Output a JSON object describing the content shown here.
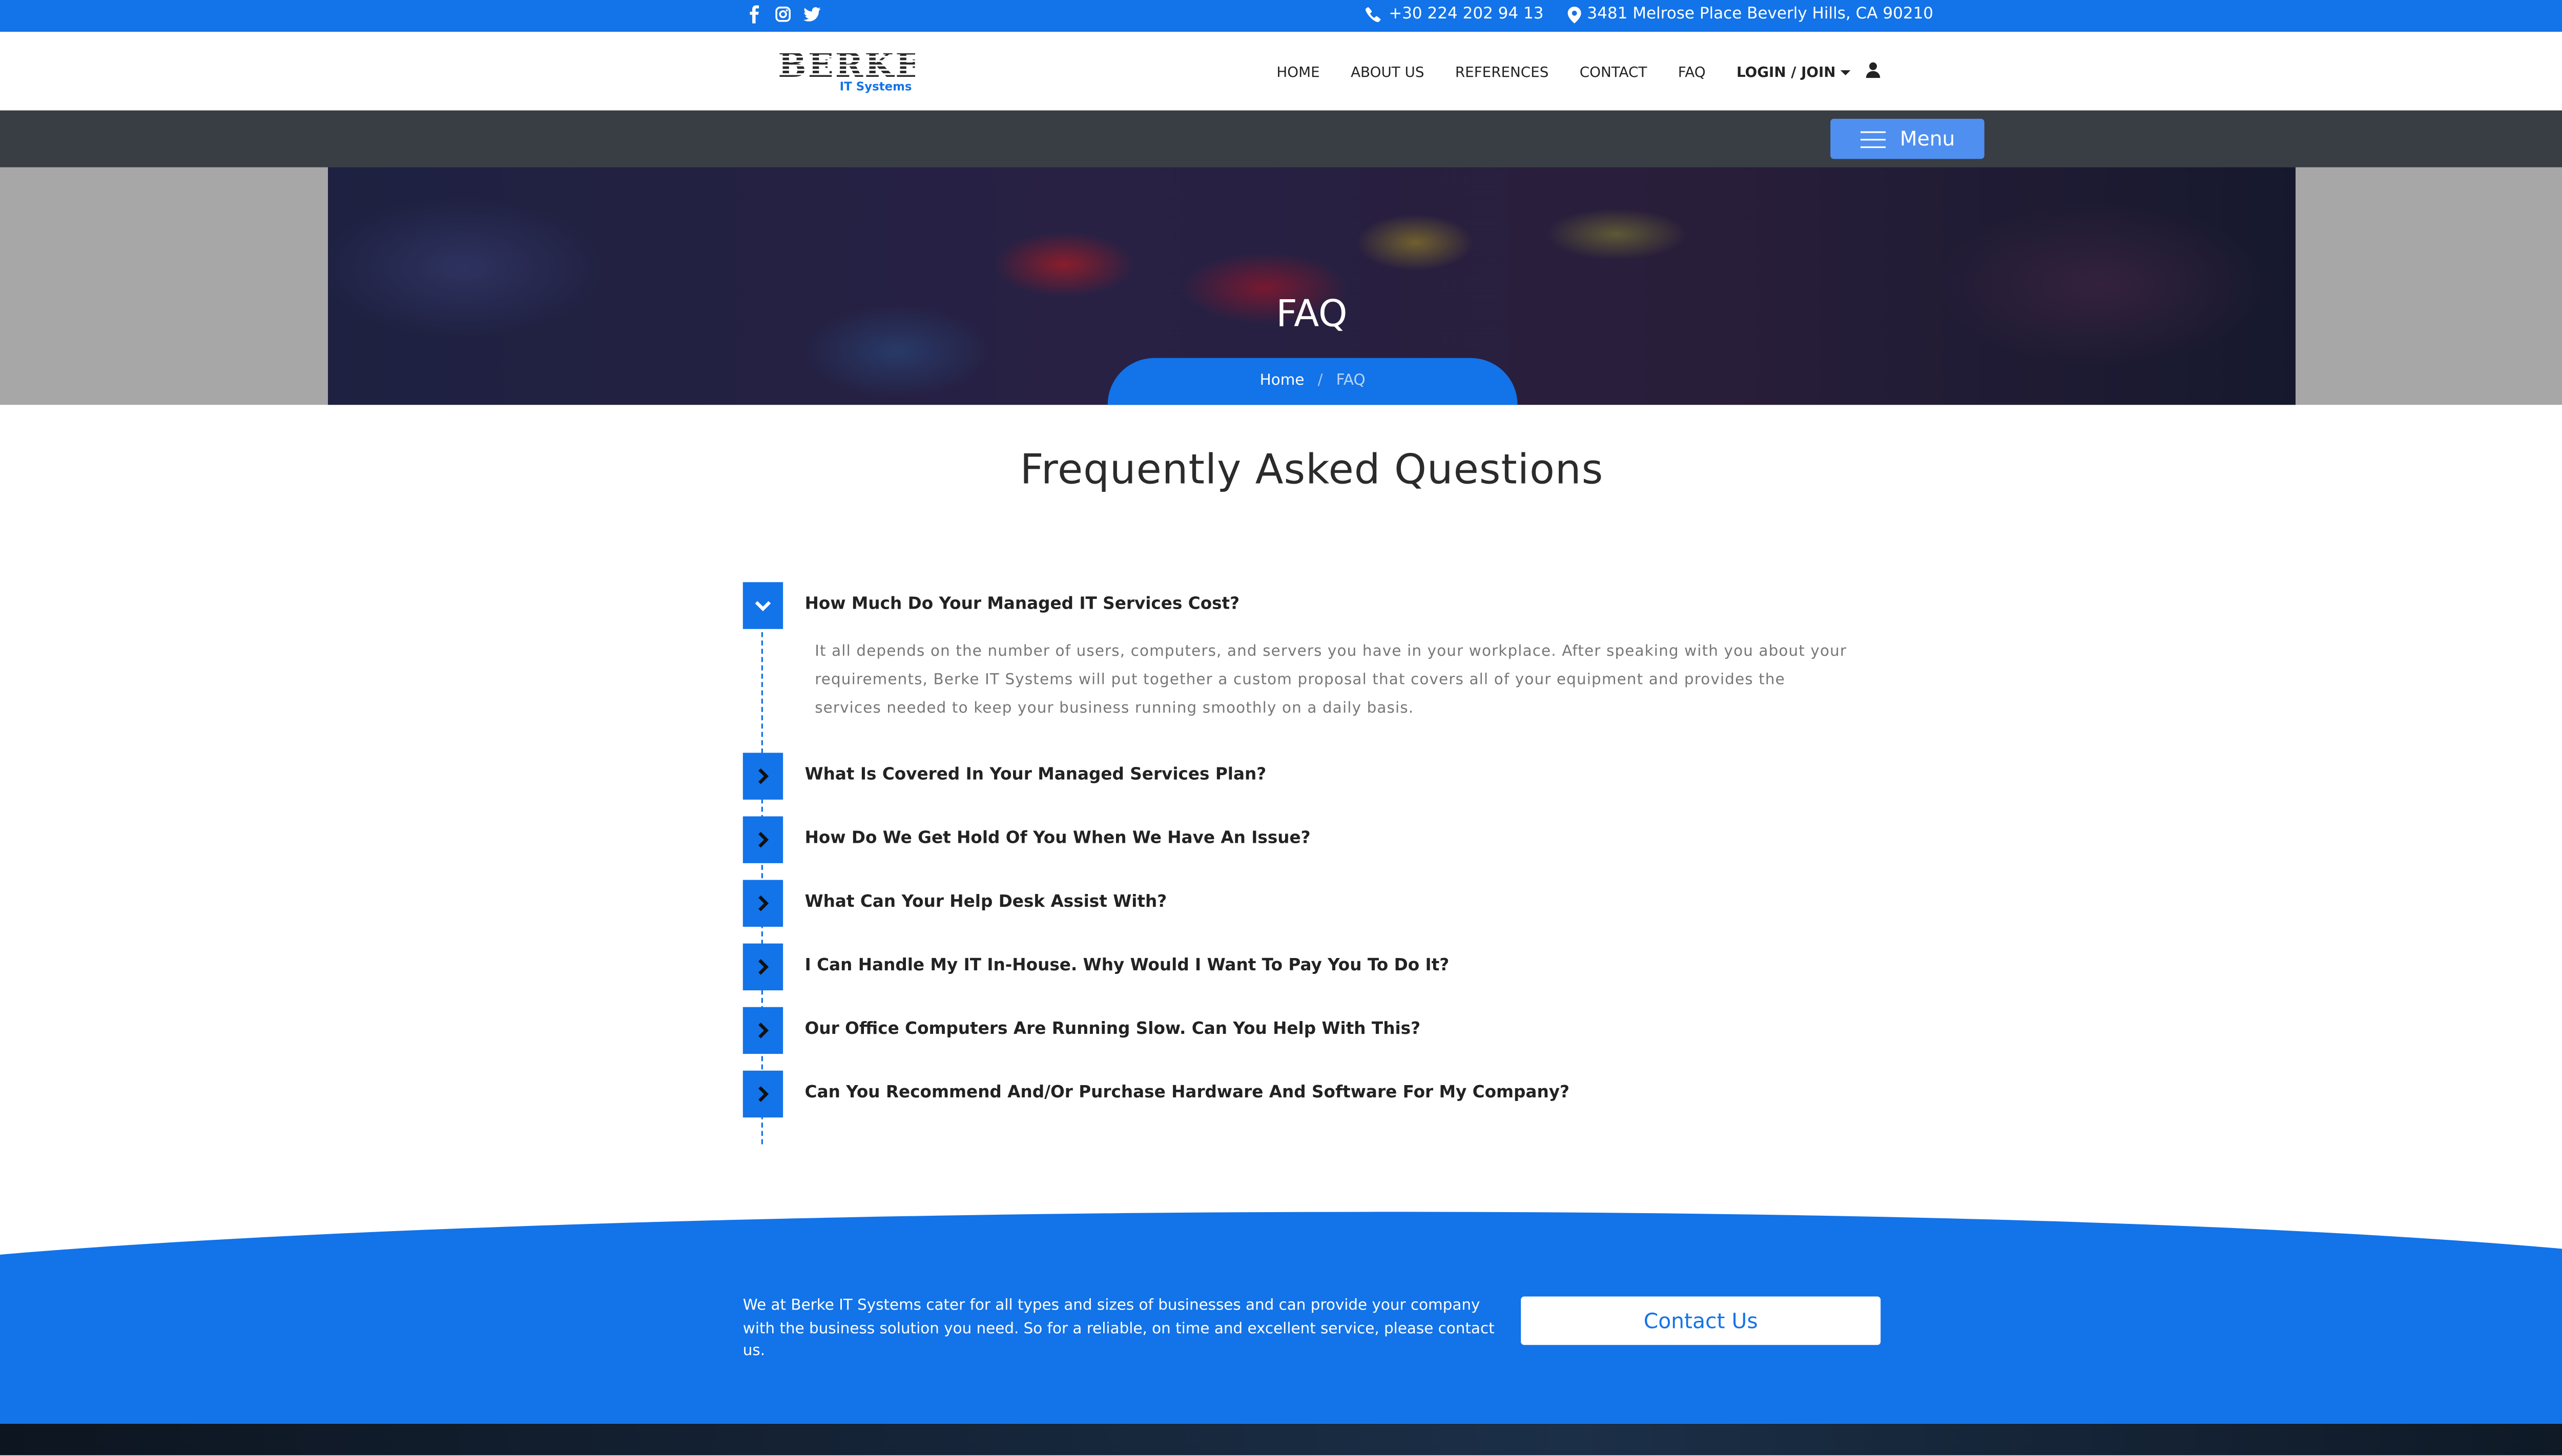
{
  "topbar": {
    "social_icons": [
      "facebook-icon",
      "instagram-icon",
      "twitter-icon"
    ],
    "phone": "+30 224 202 94 13",
    "address": "3481 Melrose Place Beverly Hills, CA 90210"
  },
  "header": {
    "logo_word": "BERKE",
    "logo_sub": "IT Systems",
    "nav": [
      "HOME",
      "ABOUT US",
      "REFERENCES",
      "CONTACT",
      "FAQ"
    ],
    "login_label": "LOGIN / JOIN"
  },
  "menubar": {
    "menu_label": "Menu"
  },
  "hero": {
    "title": "FAQ",
    "breadcrumb": {
      "home": "Home",
      "separator": "/",
      "current": "FAQ"
    }
  },
  "faq": {
    "heading": "Frequently Asked Questions",
    "items": [
      {
        "question": "How Much Do Your Managed IT Services Cost?",
        "expanded": true,
        "answer": "It all depends on the number of users, computers, and servers you have in your workplace. After speaking with you about your requirements, Berke IT Systems will put together a custom proposal that covers all of your equipment and provides the services needed to keep your business running smoothly on a daily basis."
      },
      {
        "question": "What Is Covered In Your Managed Services Plan?",
        "expanded": false
      },
      {
        "question": "How Do We Get Hold Of You When We Have An Issue?",
        "expanded": false
      },
      {
        "question": "What Can Your Help Desk Assist With?",
        "expanded": false
      },
      {
        "question": "I Can Handle My IT In-House. Why Would I Want To Pay You To Do It?",
        "expanded": false
      },
      {
        "question": "Our Office Computers Are Running Slow. Can You Help With This?",
        "expanded": false
      },
      {
        "question": "Can You Recommend And/Or Purchase Hardware And Software For My Company?",
        "expanded": false
      }
    ]
  },
  "cta": {
    "text": "We at Berke IT Systems cater for all types and sizes of businesses and can provide your company with the business solution you need. So for a reliable, on time and excellent service, please contact us.",
    "button_label": "Contact Us"
  },
  "colors": {
    "brand_blue": "#1373e8",
    "menubar": "#393d44",
    "menu_button": "#4f8ff0"
  }
}
